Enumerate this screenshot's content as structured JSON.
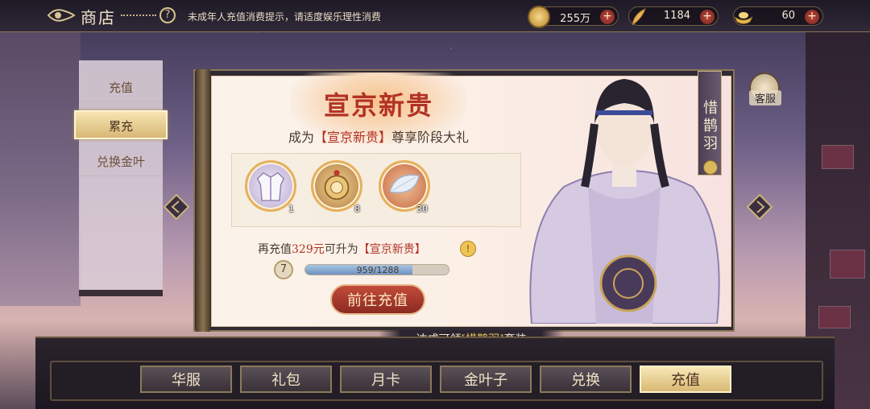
{
  "header": {
    "title": "商店",
    "notice": "未成年人充值消费提示，请适度娱乐理性消费",
    "resources": [
      {
        "name": "coin",
        "value": "255万",
        "icon": "coin-icon"
      },
      {
        "name": "feather",
        "value": "1184",
        "icon": "feather-icon"
      },
      {
        "name": "ingot",
        "value": "60",
        "icon": "ingot-icon"
      }
    ]
  },
  "sidebar": {
    "items": [
      {
        "label": "充值",
        "active": false
      },
      {
        "label": "累充",
        "active": true
      },
      {
        "label": "兑换金叶",
        "active": false
      }
    ]
  },
  "card": {
    "title": "宣京新贵",
    "subtitle_prefix": "成为",
    "subtitle_highlight": "【宣京新贵】",
    "subtitle_suffix": "尊享阶段大礼",
    "rewards": [
      {
        "name": "outfit",
        "count": "1"
      },
      {
        "name": "golden-compass",
        "count": "8"
      },
      {
        "name": "crystal-leaf",
        "count": "30"
      }
    ],
    "upgrade_prefix": "再充值",
    "upgrade_amount": "329元",
    "upgrade_middle": "可升为",
    "upgrade_target": "【宣京新贵】",
    "level": "7",
    "progress_text": "959/1288",
    "progress_fraction": 0.745,
    "go_button": "前往充值"
  },
  "character": {
    "name": "惜鹊羽"
  },
  "service": {
    "label": "客服"
  },
  "reward_banner": {
    "prefix": "达成可领",
    "highlight": "[惜鹊羽]",
    "suffix": "套装"
  },
  "tabs": [
    {
      "label": "华服",
      "active": false
    },
    {
      "label": "礼包",
      "active": false
    },
    {
      "label": "月卡",
      "active": false
    },
    {
      "label": "金叶子",
      "active": false
    },
    {
      "label": "兑换",
      "active": false
    },
    {
      "label": "充值",
      "active": true
    }
  ],
  "colors": {
    "accent_red": "#b23224",
    "gold": "#d8b874",
    "progress_blue": "#6f93c0"
  }
}
